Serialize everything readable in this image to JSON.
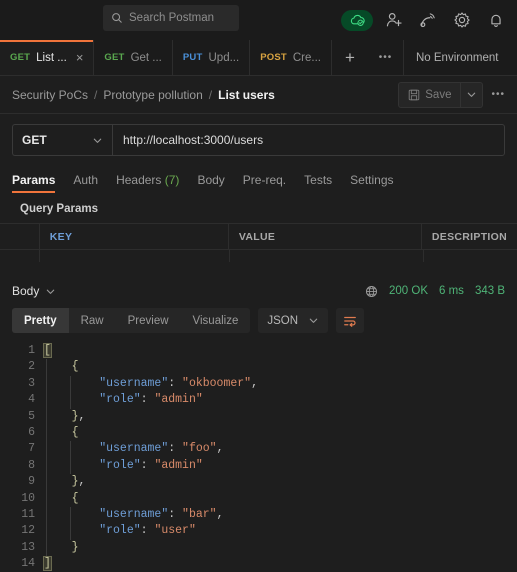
{
  "topbar": {
    "search": {
      "placeholder": "Search Postman",
      "icon": "search-icon"
    },
    "icons": [
      {
        "name": "cloud-sync-status-icon",
        "label": ""
      },
      {
        "name": "invite-person-icon",
        "label": ""
      },
      {
        "name": "satellite-icon",
        "label": ""
      },
      {
        "name": "gear-icon",
        "label": ""
      },
      {
        "name": "bell-icon",
        "label": ""
      }
    ]
  },
  "tabs": {
    "items": [
      {
        "method": "GET",
        "name": "List ...",
        "active": true,
        "color": "#5aa84f"
      },
      {
        "method": "GET",
        "name": "Get ...",
        "active": false,
        "color": "#5aa84f"
      },
      {
        "method": "PUT",
        "name": "Upd...",
        "active": false,
        "color": "#4a90d9"
      },
      {
        "method": "POST",
        "name": "Cre...",
        "active": false,
        "color": "#d9a441"
      }
    ],
    "close_glyph": "×",
    "add_label": "+",
    "more_label": "•••",
    "environment": "No Environment"
  },
  "breadcrumb": {
    "items": [
      "Security PoCs",
      "Prototype pollution",
      "List users"
    ],
    "separator": "/",
    "save_label": "Save",
    "save_icon": "floppy-disk-icon",
    "caret_icon": "chevron-down-icon",
    "more_label": "•••"
  },
  "request": {
    "method": "GET",
    "url": "http://localhost:3000/users",
    "tabs": [
      {
        "label": "Params",
        "count": "",
        "active": true
      },
      {
        "label": "Auth",
        "count": "",
        "active": false
      },
      {
        "label": "Headers",
        "count": "(7)",
        "active": false
      },
      {
        "label": "Body",
        "count": "",
        "active": false
      },
      {
        "label": "Pre-req.",
        "count": "",
        "active": false
      },
      {
        "label": "Tests",
        "count": "",
        "active": false
      },
      {
        "label": "Settings",
        "count": "",
        "active": false
      }
    ],
    "query_params_title": "Query Params",
    "table_headers": [
      "KEY",
      "VALUE",
      "DESCRIPTION"
    ]
  },
  "response": {
    "body_label": "Body",
    "caret_icon": "chevron-down-icon",
    "globe_icon": "globe-icon",
    "status": "200 OK",
    "time": "6 ms",
    "size": "343 B",
    "view_tabs": [
      {
        "label": "Pretty",
        "active": true
      },
      {
        "label": "Raw",
        "active": false
      },
      {
        "label": "Preview",
        "active": false
      },
      {
        "label": "Visualize",
        "active": false
      }
    ],
    "format": "JSON",
    "wrap_icon": "wrap-text-icon",
    "code_lines": [
      {
        "n": "1",
        "indent": 0,
        "tokens": [
          {
            "t": "bracket-hl",
            "v": "["
          }
        ]
      },
      {
        "n": "2",
        "indent": 1,
        "tokens": [
          {
            "t": "bracket",
            "v": "{"
          }
        ]
      },
      {
        "n": "3",
        "indent": 2,
        "tokens": [
          {
            "t": "key",
            "v": "\"username\""
          },
          {
            "t": "punct",
            "v": ": "
          },
          {
            "t": "str",
            "v": "\"okboomer\""
          },
          {
            "t": "punct",
            "v": ","
          }
        ]
      },
      {
        "n": "4",
        "indent": 2,
        "tokens": [
          {
            "t": "key",
            "v": "\"role\""
          },
          {
            "t": "punct",
            "v": ": "
          },
          {
            "t": "str",
            "v": "\"admin\""
          }
        ]
      },
      {
        "n": "5",
        "indent": 1,
        "tokens": [
          {
            "t": "bracket",
            "v": "}"
          },
          {
            "t": "punct",
            "v": ","
          }
        ]
      },
      {
        "n": "6",
        "indent": 1,
        "tokens": [
          {
            "t": "bracket",
            "v": "{"
          }
        ]
      },
      {
        "n": "7",
        "indent": 2,
        "tokens": [
          {
            "t": "key",
            "v": "\"username\""
          },
          {
            "t": "punct",
            "v": ": "
          },
          {
            "t": "str",
            "v": "\"foo\""
          },
          {
            "t": "punct",
            "v": ","
          }
        ]
      },
      {
        "n": "8",
        "indent": 2,
        "tokens": [
          {
            "t": "key",
            "v": "\"role\""
          },
          {
            "t": "punct",
            "v": ": "
          },
          {
            "t": "str",
            "v": "\"admin\""
          }
        ]
      },
      {
        "n": "9",
        "indent": 1,
        "tokens": [
          {
            "t": "bracket",
            "v": "}"
          },
          {
            "t": "punct",
            "v": ","
          }
        ]
      },
      {
        "n": "10",
        "indent": 1,
        "tokens": [
          {
            "t": "bracket",
            "v": "{"
          }
        ]
      },
      {
        "n": "11",
        "indent": 2,
        "tokens": [
          {
            "t": "key",
            "v": "\"username\""
          },
          {
            "t": "punct",
            "v": ": "
          },
          {
            "t": "str",
            "v": "\"bar\""
          },
          {
            "t": "punct",
            "v": ","
          }
        ]
      },
      {
        "n": "12",
        "indent": 2,
        "tokens": [
          {
            "t": "key",
            "v": "\"role\""
          },
          {
            "t": "punct",
            "v": ": "
          },
          {
            "t": "str",
            "v": "\"user\""
          }
        ]
      },
      {
        "n": "13",
        "indent": 1,
        "tokens": [
          {
            "t": "bracket",
            "v": "}"
          }
        ]
      },
      {
        "n": "14",
        "indent": 0,
        "tokens": [
          {
            "t": "bracket-hl",
            "v": "]"
          }
        ]
      }
    ]
  },
  "colors": {
    "accent": "#f0743b",
    "success": "#4fb477",
    "method_get": "#5aa84f",
    "method_put": "#4a90d9",
    "method_post": "#d9a441",
    "json_key": "#6f9fd8",
    "json_string": "#d98b6a"
  }
}
